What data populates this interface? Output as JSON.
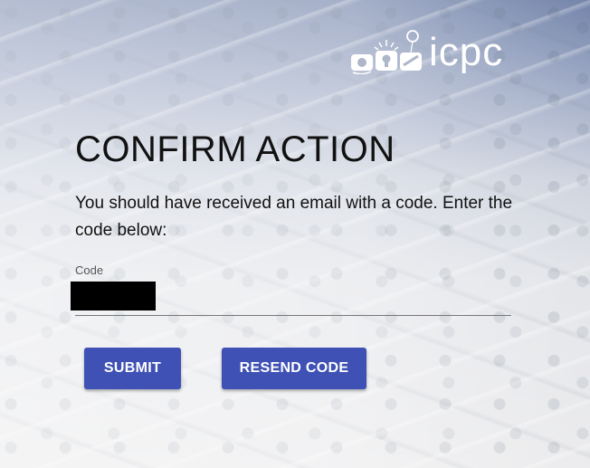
{
  "brand": {
    "logo_text": "icpc",
    "logo_color": "#ffffff"
  },
  "form": {
    "title": "CONFIRM ACTION",
    "instructions": "You should have received an email with a code. Enter the code below:",
    "code_label": "Code",
    "code_value": ""
  },
  "actions": {
    "submit_label": "SUBMIT",
    "resend_label": "RESEND CODE",
    "button_color": "#3f51b5"
  }
}
